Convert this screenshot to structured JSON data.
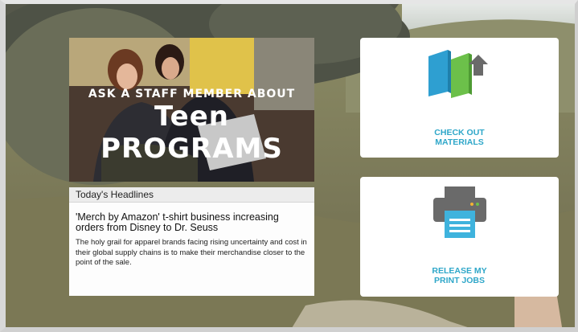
{
  "promo": {
    "line1": "ASK A STAFF MEMBER ABOUT",
    "line2": "Teen PROGRAMS"
  },
  "headlines": {
    "header": "Today's Headlines",
    "title": "'Merch by Amazon' t-shirt business increasing orders from Disney to Dr. Seuss",
    "body": "The holy grail for apparel brands facing rising uncertainty and cost in their global supply chains is to make their merchandise closer to the point of the sale."
  },
  "tiles": {
    "checkout": {
      "line1": "CHECK OUT",
      "line2": "MATERIALS",
      "icon": "books-upload-icon"
    },
    "print": {
      "line1": "RELEASE MY",
      "line2": "PRINT JOBS",
      "icon": "printer-icon"
    }
  },
  "colors": {
    "accent": "#2fa7c9",
    "book_blue": "#2e9fd1",
    "book_green": "#6cc04a",
    "icon_gray": "#6a6a6a"
  }
}
